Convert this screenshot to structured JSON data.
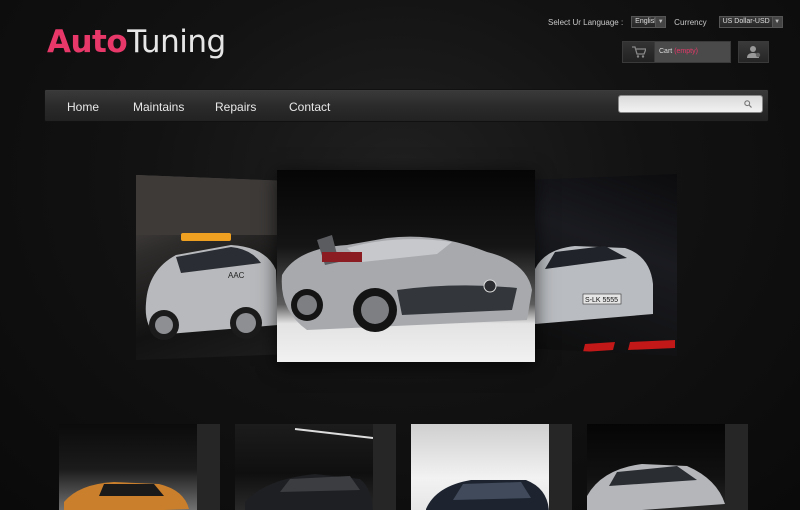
{
  "header": {
    "logo_part1": "Auto",
    "logo_part2": "Tuning",
    "language_label": "Select Ur Language :",
    "language_value": "English",
    "currency_label": "Currency",
    "currency_value": "US Dollar-USD",
    "cart_label": "Cart",
    "cart_status": "(empty)"
  },
  "nav": {
    "items": [
      "Home",
      "Maintains",
      "Repairs",
      "Contact"
    ],
    "search_placeholder": ""
  },
  "slider": {
    "slides": [
      "slide-left",
      "slide-center",
      "slide-right"
    ],
    "left_plate": "AAC",
    "right_plate": "S-LK 5555"
  },
  "thumbnails": {
    "count": 4
  },
  "colors": {
    "accent": "#e8386a",
    "background": "#121212",
    "nav_bar": "#2b2b2b"
  }
}
